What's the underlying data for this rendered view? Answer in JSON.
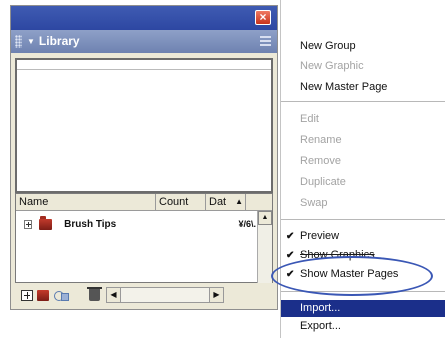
{
  "panel": {
    "title": "Library",
    "columns": {
      "name": "Name",
      "count": "Count",
      "date": "Dat"
    },
    "rows": [
      {
        "name": "Brush Tips",
        "date": "¥/6\\."
      }
    ]
  },
  "menu": {
    "items": [
      {
        "label": "New Group",
        "enabled": true,
        "checked": false
      },
      {
        "label": "New Graphic",
        "enabled": false,
        "checked": false
      },
      {
        "label": "New Master Page",
        "enabled": true,
        "checked": false
      },
      {
        "label": "Edit",
        "enabled": false,
        "checked": false
      },
      {
        "label": "Rename",
        "enabled": false,
        "checked": false
      },
      {
        "label": "Remove",
        "enabled": false,
        "checked": false
      },
      {
        "label": "Duplicate",
        "enabled": false,
        "checked": false
      },
      {
        "label": "Swap",
        "enabled": false,
        "checked": false
      },
      {
        "label": "Preview",
        "enabled": true,
        "checked": true
      },
      {
        "label": "Show Graphics",
        "enabled": true,
        "checked": true
      },
      {
        "label": "Show Master Pages",
        "enabled": true,
        "checked": true
      },
      {
        "label": "Import...",
        "enabled": true,
        "checked": false,
        "highlighted": true
      },
      {
        "label": "Export...",
        "enabled": true,
        "checked": false
      }
    ]
  },
  "colors": {
    "highlight": "#1b2f8a",
    "annotation": "#3a57b5",
    "titlebar": "#7b8fbd"
  }
}
